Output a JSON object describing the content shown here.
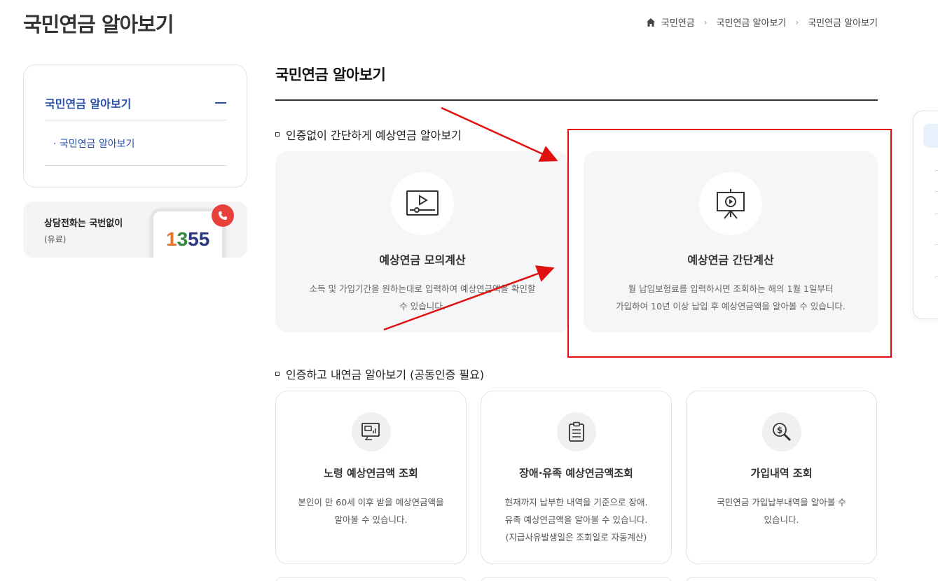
{
  "header": {
    "page_title": "국민연금 알아보기",
    "breadcrumb": [
      "국민연금",
      "국민연금 알아보기",
      "국민연금 알아보기"
    ],
    "home_icon": "home-icon"
  },
  "sidebar": {
    "menu_title": "국민연금 알아보기",
    "sub_items": [
      {
        "label": "· 국민연금 알아보기"
      }
    ]
  },
  "callbox": {
    "title": "상담전화는 국번없이",
    "subtitle": "(유료)",
    "number_digits": [
      {
        "d": "1",
        "color": "#e8742b"
      },
      {
        "d": "3",
        "color": "#2f8a3c"
      },
      {
        "d": "5",
        "color": "#2a3580"
      },
      {
        "d": "5",
        "color": "#2a3580"
      }
    ]
  },
  "main": {
    "title": "국민연금 알아보기",
    "section1": {
      "title": "인증없이 간단하게 예상연금 알아보기",
      "cards": [
        {
          "title": "예상연금 모의계산",
          "desc1": "소득 및 가입기간을 원하는대로 입력하여 예상연금액을 확인할",
          "desc2": "수 있습니다.",
          "icon": "video-play-icon"
        },
        {
          "title": "예상연금 간단계산",
          "desc1": "월 납입보험료를 입력하시면 조회하는 해의 1월 1일부터",
          "desc2": "가입하여 10년 이상 납입 후 예상연금액을 알아볼 수 있습니다.",
          "icon": "presentation-play-icon"
        }
      ]
    },
    "section2": {
      "title": "인증하고 내연금 알아보기 (공동인증 필요)",
      "cards": [
        {
          "title": "노령 예상연금액 조회",
          "desc1": "본인이 만 60세 이후 받을 예상연금액을",
          "desc2": "알아볼 수 있습니다.",
          "desc3": "",
          "icon": "monitor-chart-icon"
        },
        {
          "title": "장애·유족 예상연금액조회",
          "desc1": "현재까지 납부한 내역을 기준으로 장애.",
          "desc2": "유족 예상연금액을 알아볼 수 있습니다.",
          "desc3": "(지급사유발생일은 조회일로 자동계산)",
          "icon": "clipboard-icon"
        },
        {
          "title": "가입내역 조회",
          "desc1": "국민연금 가입납부내역을 알아볼 수",
          "desc2": "있습니다.",
          "desc3": "",
          "icon": "search-dollar-icon"
        }
      ]
    }
  },
  "annotation": {
    "highlight_color": "#e01010"
  }
}
